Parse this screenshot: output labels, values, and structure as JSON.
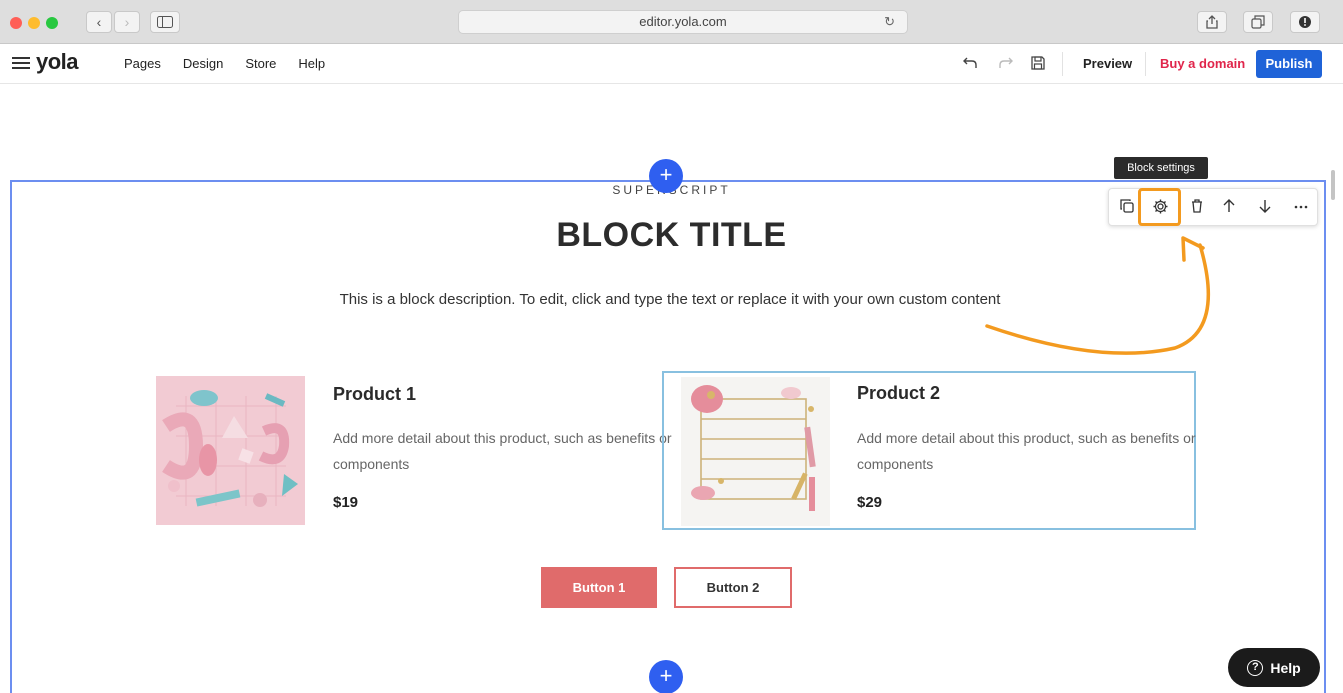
{
  "browser": {
    "url": "editor.yola.com",
    "reload_glyph": "↻",
    "back_glyph": "‹",
    "forward_glyph": "›"
  },
  "app": {
    "logo": "yola",
    "menu": [
      "Pages",
      "Design",
      "Store",
      "Help"
    ],
    "preview_label": "Preview",
    "buy_domain_label": "Buy a domain",
    "publish_label": "Publish",
    "publish_color": "#1f63d8",
    "buy_domain_color": "#e0254b"
  },
  "block": {
    "superscript": "SUPERSCRIPT",
    "title": "BLOCK TITLE",
    "description": "This is a block description. To edit, click and type the text or replace it with your own custom content",
    "products": [
      {
        "title": "Product 1",
        "description": "Add more detail about this product, such as benefits or components",
        "price": "$19"
      },
      {
        "title": "Product 2",
        "description": "Add more detail about this product, such as benefits or components",
        "price": "$29"
      }
    ],
    "button_1": "Button 1",
    "button_2": "Button 2",
    "button_color": "#e06b6b"
  },
  "block_toolbar": {
    "tooltip": "Block settings",
    "icons": [
      "duplicate-icon",
      "gear-icon",
      "trash-icon",
      "arrow-up-icon",
      "arrow-down-icon",
      "more-icon"
    ],
    "highlight_color": "#f39a1f"
  },
  "help": {
    "label": "Help",
    "icon_glyph": "?"
  },
  "add_glyph": "+"
}
